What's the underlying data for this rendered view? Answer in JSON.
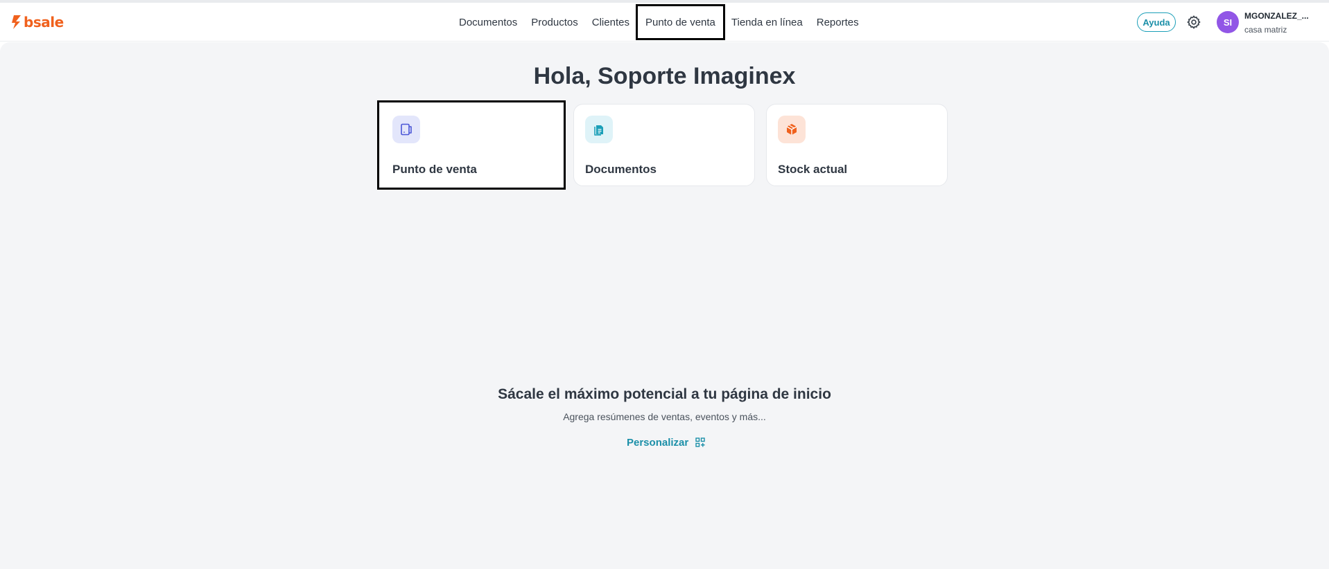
{
  "brand": {
    "name": "bsale",
    "color": "#f0611d"
  },
  "nav": {
    "items": [
      {
        "label": "Documentos"
      },
      {
        "label": "Productos"
      },
      {
        "label": "Clientes"
      },
      {
        "label": "Punto de venta",
        "active": true
      },
      {
        "label": "Tienda en línea"
      },
      {
        "label": "Reportes"
      }
    ]
  },
  "header": {
    "help_label": "Ayuda",
    "settings_icon": "gear-icon",
    "user": {
      "initials": "SI",
      "name": "MGONZALEZ_...",
      "branch": "casa matriz",
      "avatar_color": "#9156e6"
    }
  },
  "main": {
    "greeting": "Hola, Soporte Imaginex",
    "shortcuts": [
      {
        "label": "Punto de venta",
        "icon": "pos-terminal-icon",
        "icon_bg": "#e3e6fb",
        "icon_color": "#4a55d6",
        "selected": true
      },
      {
        "label": "Documentos",
        "icon": "document-icon",
        "icon_bg": "#dff3f8",
        "icon_color": "#1b9fb8"
      },
      {
        "label": "Stock actual",
        "icon": "box-icon",
        "icon_bg": "#fde3d7",
        "icon_color": "#f0611d"
      }
    ],
    "promo": {
      "title": "Sácale el máximo potencial a tu página de inicio",
      "subtitle": "Agrega resúmenes de ventas, eventos y más...",
      "action_label": "Personalizar",
      "action_icon": "grid-plus-icon"
    }
  }
}
